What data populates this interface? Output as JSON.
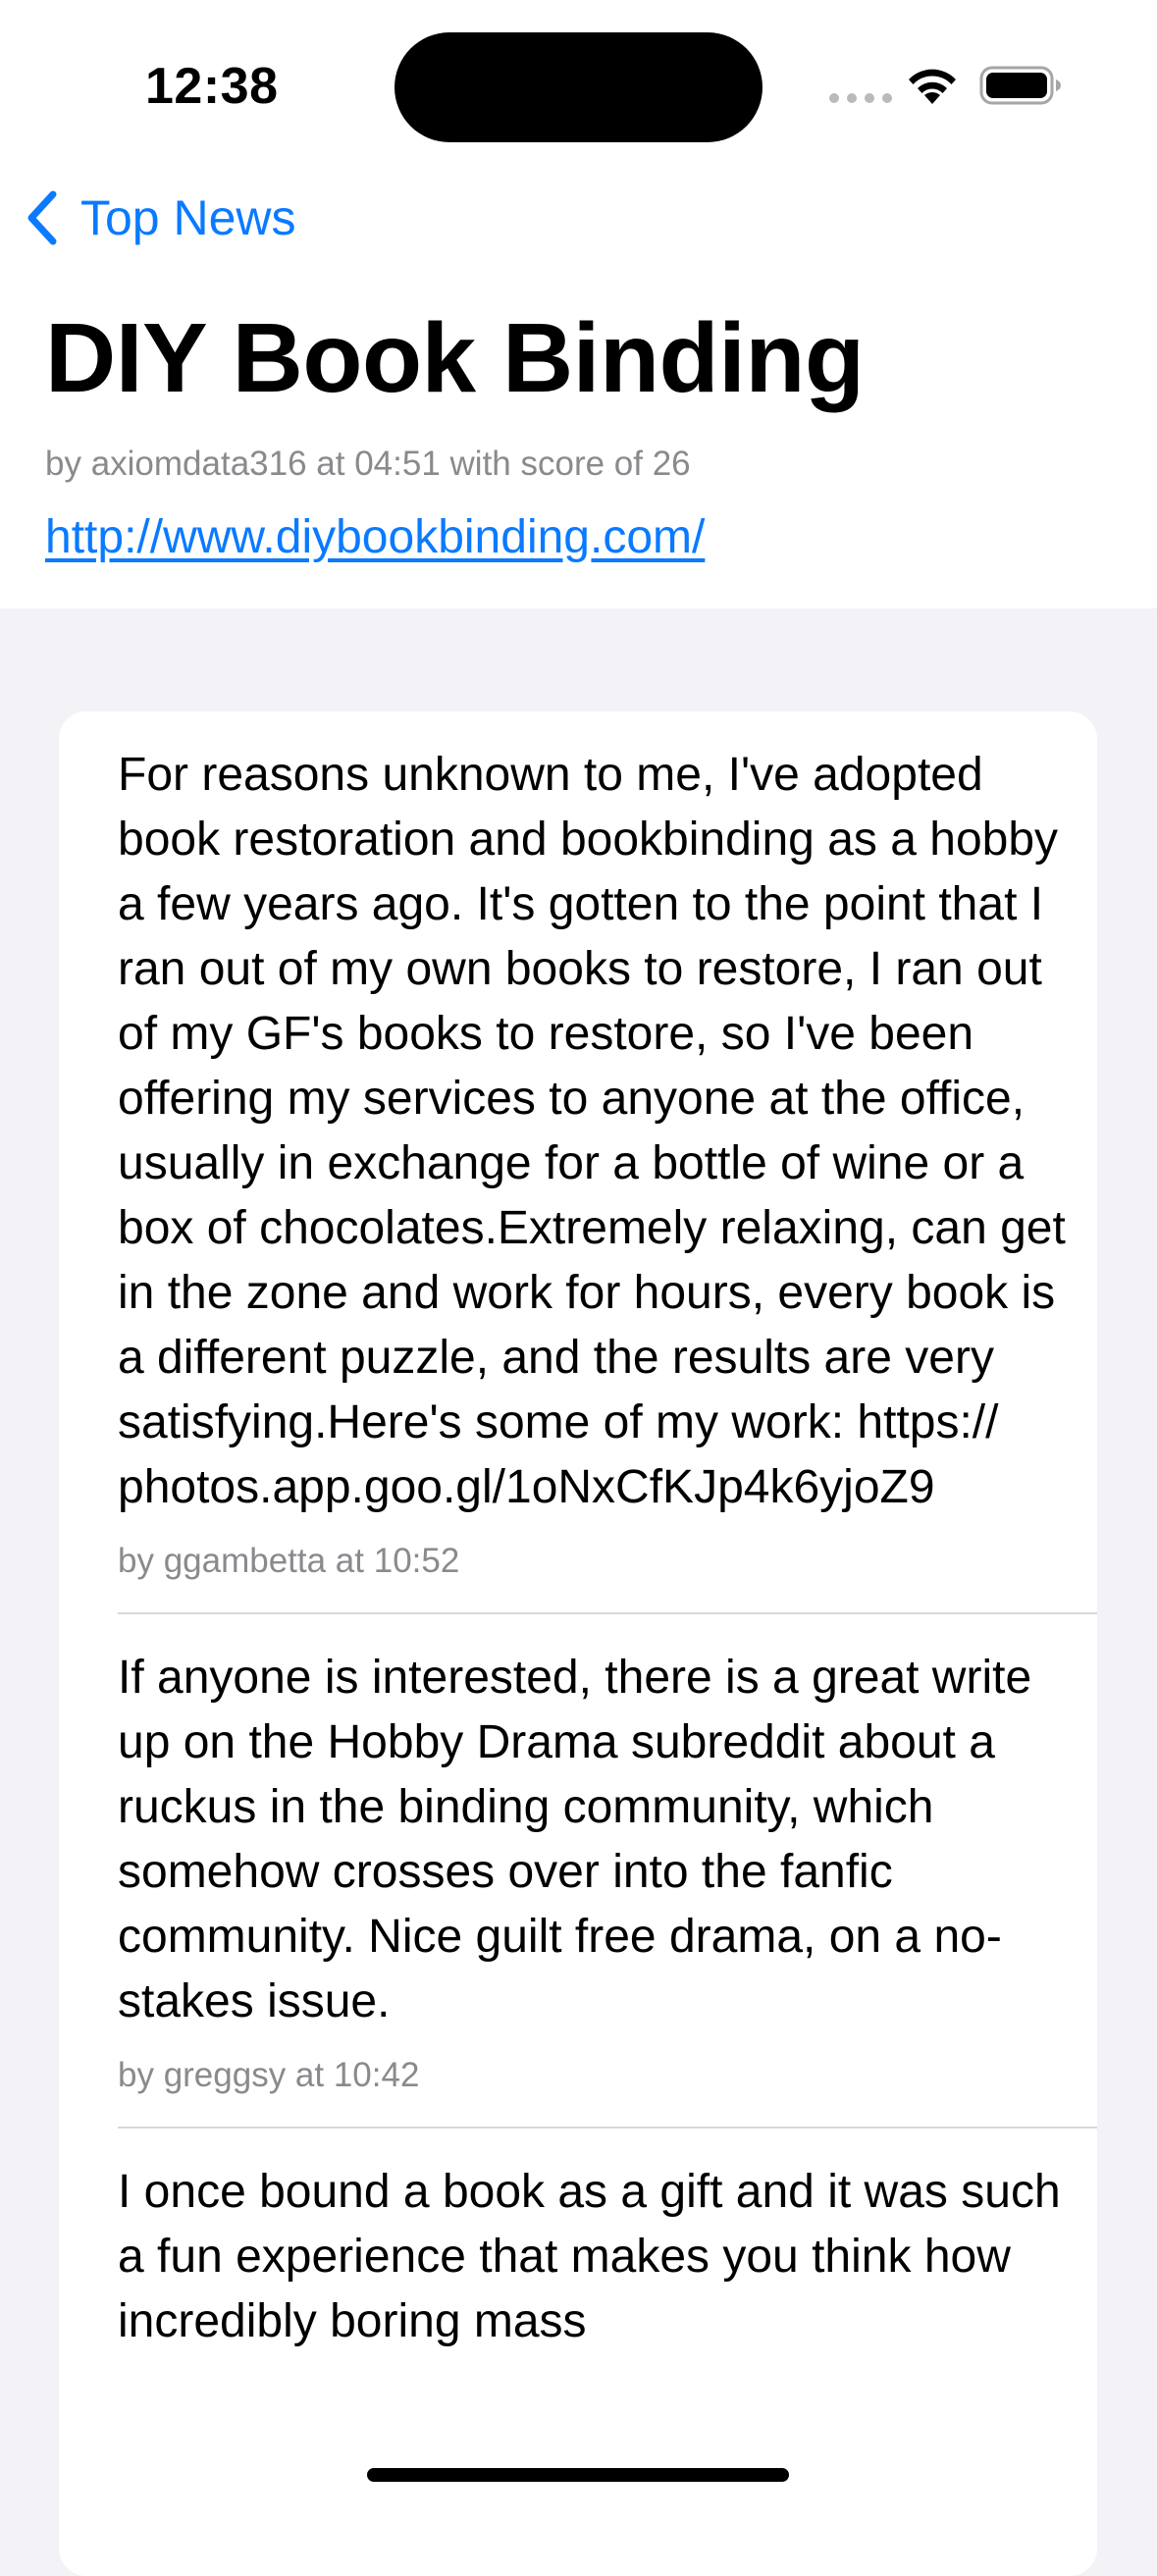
{
  "status_bar": {
    "time": "12:38"
  },
  "nav": {
    "back_label": "Top News"
  },
  "story": {
    "title": "DIY Book Binding",
    "byline": "by axiomdata316 at 04:51 with score of 26",
    "url": "http://www.diybookbinding.com/"
  },
  "comments": [
    {
      "text": "For reasons unknown to me, I've adopted book restoration and bookbinding as a hobby a few years ago. It's gotten to the point that I ran out of my own books to restore, I ran out of my GF's books to restore, so I've been offering my services to anyone at the office, usually in exchange for a bottle of wine or a box of chocolates.Extremely relaxing, can get in the zone and work for hours, every book is a different puzzle, and the results are very satisfying.Here's some of my work: https:// photos.app.goo.gl/1oNxCfKJp4k6yjoZ9",
      "meta": "by ggambetta at 10:52"
    },
    {
      "text": "If anyone is interested, there is a great write up on the Hobby Drama subreddit about a ruckus in the binding community, which somehow crosses over into the fanfic community. Nice guilt free drama, on a no-stakes issue.",
      "meta": "by greggsy at 10:42"
    },
    {
      "text": "I once bound a book as a gift and it was such a fun experience that makes you think how incredibly boring mass",
      "meta": ""
    }
  ],
  "colors": {
    "accent": "#0a7aff",
    "secondary_text": "#8a8a8e",
    "background": "#f2f2f7",
    "card": "#ffffff"
  },
  "icons": {
    "back": "chevron-left-icon",
    "wifi": "wifi-icon",
    "battery": "battery-icon",
    "signal": "cellular-signal-icon"
  }
}
